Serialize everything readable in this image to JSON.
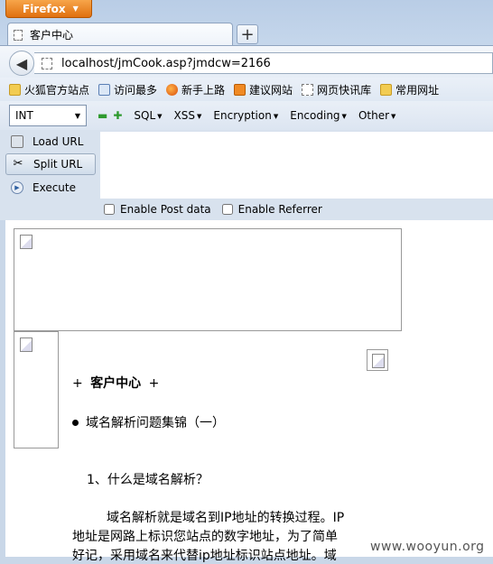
{
  "browser": {
    "app_button": "Firefox",
    "tab_title": "客户中心",
    "new_tab_symbol": "+",
    "url": "localhost/jmCook.asp?jmdcw=2166"
  },
  "bookmarks": [
    {
      "label": "火狐官方站点",
      "icon": "folder-icon"
    },
    {
      "label": "访问最多",
      "icon": "person-icon"
    },
    {
      "label": "新手上路",
      "icon": "firefox-icon"
    },
    {
      "label": "建议网站",
      "icon": "bulb-icon"
    },
    {
      "label": "网页快讯库",
      "icon": "dashed-page-icon"
    },
    {
      "label": "常用网址",
      "icon": "folder-icon"
    }
  ],
  "hackbar": {
    "select_value": "INT",
    "menus": [
      "SQL",
      "XSS",
      "Encryption",
      "Encoding",
      "Other"
    ],
    "buttons": [
      "Load URL",
      "Split URL",
      "Execute"
    ],
    "checkboxes": [
      "Enable Post data",
      "Enable Referrer"
    ]
  },
  "page": {
    "heading": "客户中心",
    "heading_decor": "+",
    "list_item": "域名解析问题集锦（一）",
    "question": "1、什么是域名解析？",
    "para1": "域名解析就是域名到IP地址的转换过程。IP",
    "para2": "地址是网路上标识您站点的数字地址，为了简单",
    "para3": "好记，采用域名来代替ip地址标识站点地址。域"
  },
  "watermark": "www.wooyun.org",
  "colors": {
    "chrome": "#c9d7e8",
    "firefox_button": "#e8821f",
    "plus_minus": "#2e9a2e"
  }
}
